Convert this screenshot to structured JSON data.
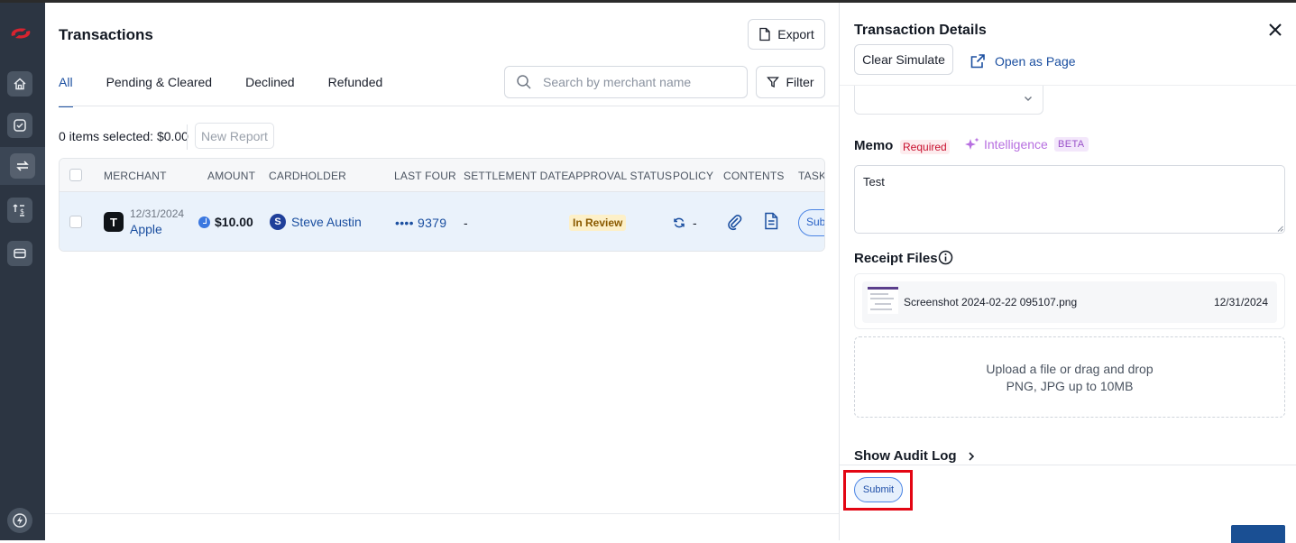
{
  "main": {
    "title": "Transactions",
    "export_label": "Export",
    "filter_label": "Filter",
    "tabs": [
      {
        "label": "All",
        "active": true
      },
      {
        "label": "Pending & Cleared"
      },
      {
        "label": "Declined"
      },
      {
        "label": "Refunded"
      }
    ],
    "search": {
      "placeholder": "Search by merchant name"
    },
    "selection_text": "0 items selected: $0.00",
    "new_report_label": "New Report",
    "table": {
      "headers": [
        "MERCHANT",
        "AMOUNT",
        "CARDHOLDER",
        "LAST FOUR",
        "SETTLEMENT DATE",
        "APPROVAL STATUS",
        "POLICY",
        "CONTENTS",
        "TASKS"
      ],
      "rows": [
        {
          "merchant_initial": "T",
          "date": "12/31/2024",
          "merchant": "Apple",
          "amount": "$10.00",
          "cardholder_initial": "S",
          "cardholder": "Steve Austin",
          "last_four": "•••• 9379",
          "settlement_date": "-",
          "approval_status": "In Review",
          "policy": "-",
          "task_label": "Submit"
        }
      ]
    }
  },
  "panel": {
    "title": "Transaction Details",
    "clear_label": "Clear Simulate",
    "open_page_label": "Open as Page",
    "memo_label": "Memo",
    "required_label": "Required",
    "intelligence_label": "Intelligence",
    "beta_label": "BETA",
    "memo_value": "Test",
    "receipt_label": "Receipt Files",
    "file": {
      "name": "Screenshot 2024-02-22 095107.png",
      "date": "12/31/2024"
    },
    "upload_line1": "Upload a file or drag and drop",
    "upload_line2": "PNG, JPG up to 10MB",
    "audit_label": "Show Audit Log",
    "submit_label": "Submit"
  },
  "colors": {
    "accent": "#1b4fa0",
    "sidebar": "#2c3542",
    "highlight": "#e30613",
    "status_bg": "#fdf0c8"
  },
  "icons": [
    "logo-icon",
    "home-icon",
    "check-circle-icon",
    "transfer-icon",
    "reimburse-icon",
    "card-icon",
    "bolt-icon",
    "export-file-icon",
    "search-icon",
    "filter-icon",
    "clock-icon",
    "sync-icon",
    "paperclip-icon",
    "document-icon",
    "close-icon",
    "external-link-icon",
    "chevron-down-icon",
    "sparkle-icon",
    "info-icon",
    "chevron-right-icon"
  ]
}
